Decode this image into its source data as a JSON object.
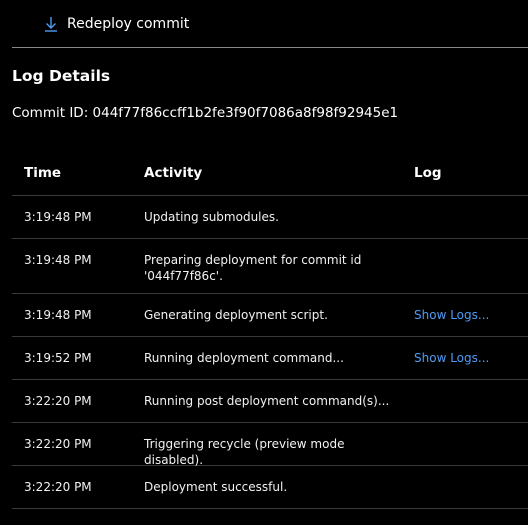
{
  "toolbar": {
    "redeploy_label": "Redeploy commit",
    "redeploy_icon": "download-arrow-icon",
    "accent_color": "#4f9cf4"
  },
  "log_details": {
    "title": "Log Details",
    "commit_line": "Commit ID: 044f77f86ccff1b2fe3f90f7086a8f98f92945e1"
  },
  "table": {
    "columns": [
      "Time",
      "Activity",
      "Log"
    ],
    "rows": [
      {
        "time": "3:19:48 PM",
        "activity": "Updating submodules.",
        "log": ""
      },
      {
        "time": "3:19:48 PM",
        "activity": "Preparing deployment for commit id '044f77f86c'.",
        "log": ""
      },
      {
        "time": "3:19:48 PM",
        "activity": "Generating deployment script.",
        "log": "Show Logs..."
      },
      {
        "time": "3:19:52 PM",
        "activity": "Running deployment command...",
        "log": "Show Logs..."
      },
      {
        "time": "3:22:20 PM",
        "activity": "Running post deployment command(s)...",
        "log": ""
      },
      {
        "time": "3:22:20 PM",
        "activity": "Triggering recycle (preview mode disabled).",
        "log": ""
      },
      {
        "time": "3:22:20 PM",
        "activity": "Deployment successful.",
        "log": ""
      }
    ]
  }
}
